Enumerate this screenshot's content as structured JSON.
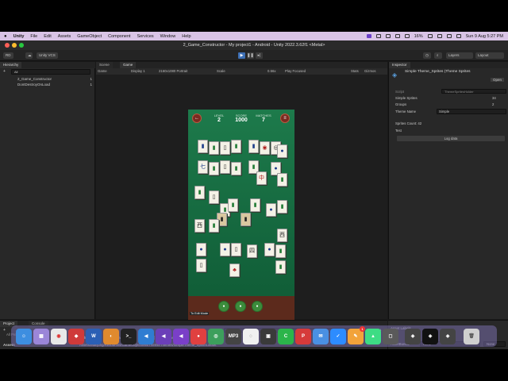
{
  "menubar": {
    "apple": "",
    "app": "Unity",
    "items": [
      "File",
      "Edit",
      "Assets",
      "GameObject",
      "Component",
      "Services",
      "Window",
      "Help"
    ],
    "battery": "16%",
    "clock": "Sun 9 Aug  5:27 PM"
  },
  "window": {
    "title": "2_Game_Constructor - My project1 - Android - Unity 2022.3.62f1 <Metal>"
  },
  "toolbar": {
    "account": "RD",
    "vcs": "Unity VCS",
    "layers": "Layers",
    "layout": "Layout"
  },
  "hierarchy": {
    "tab": "Hierarchy",
    "search": "All",
    "items": [
      {
        "label": "2_Game_Constructor",
        "badge": "1"
      },
      {
        "label": "DontDestroyOnLoad",
        "badge": "1"
      }
    ]
  },
  "center": {
    "tabs": [
      "Scene",
      "Game"
    ],
    "game_mode": "Game",
    "display": "Display 1",
    "resolution": "2160x1080 Portrait",
    "scale_label": "Scale",
    "scale_val": "0.56x",
    "play_focused": "Play Focused",
    "stats": "Stats",
    "gizmos": "Gizmos"
  },
  "game": {
    "level_label": "LEVEL",
    "level": "2",
    "score_label": "SCORE",
    "score": "1000",
    "matches_label": "MATCHES",
    "matches": "7",
    "back": "←",
    "menu": "≡",
    "edit_mode": "To Edit Mode"
  },
  "inspector": {
    "tab": "Inspector",
    "title": "Simple Theme_Sprites (Theme Sprites",
    "open": "Open",
    "script_label": "Script",
    "script_val": "ThemeSpritesHolder",
    "simple_sprites_label": "Simple Sprites",
    "simple_sprites": "34",
    "groups_label": "Groups",
    "groups": "2",
    "theme_name_label": "Theme Name",
    "theme_name": "Simple",
    "sprites_count": "Sprites Count: 42",
    "test": "Test",
    "log_data": "Log data"
  },
  "project": {
    "tabs": [
      "Project",
      "Console"
    ],
    "search_value": "icon",
    "count": "14",
    "search_label": "Search:",
    "scopes": [
      "All",
      "In Packages",
      "In Assets",
      "'Assets'"
    ],
    "path": "Assets/Mahjong/Resources/GameObjectSets/Theme/Themes/SimpleTheme_Sprites.asset",
    "tree_a": "All Prefabs",
    "tree_b": "Assets"
  },
  "asset_labels": {
    "title": "Asset Labels",
    "bundle_label": "AssetBundle",
    "bundle_val": "None",
    "variant_val": "None"
  },
  "dock": {
    "apps": [
      "Finder",
      "Launchpad",
      "Chrome",
      "App",
      "Word",
      "Blender",
      "Terminal",
      "Code",
      "VS",
      "VS",
      "App",
      "Maps",
      "MP3",
      "App",
      "App",
      "App",
      "P",
      "Mail",
      "Zoom",
      "Pages",
      "Android",
      "Box",
      "Unity",
      "Unity",
      "Unity",
      "Trash"
    ],
    "badge": "1"
  }
}
